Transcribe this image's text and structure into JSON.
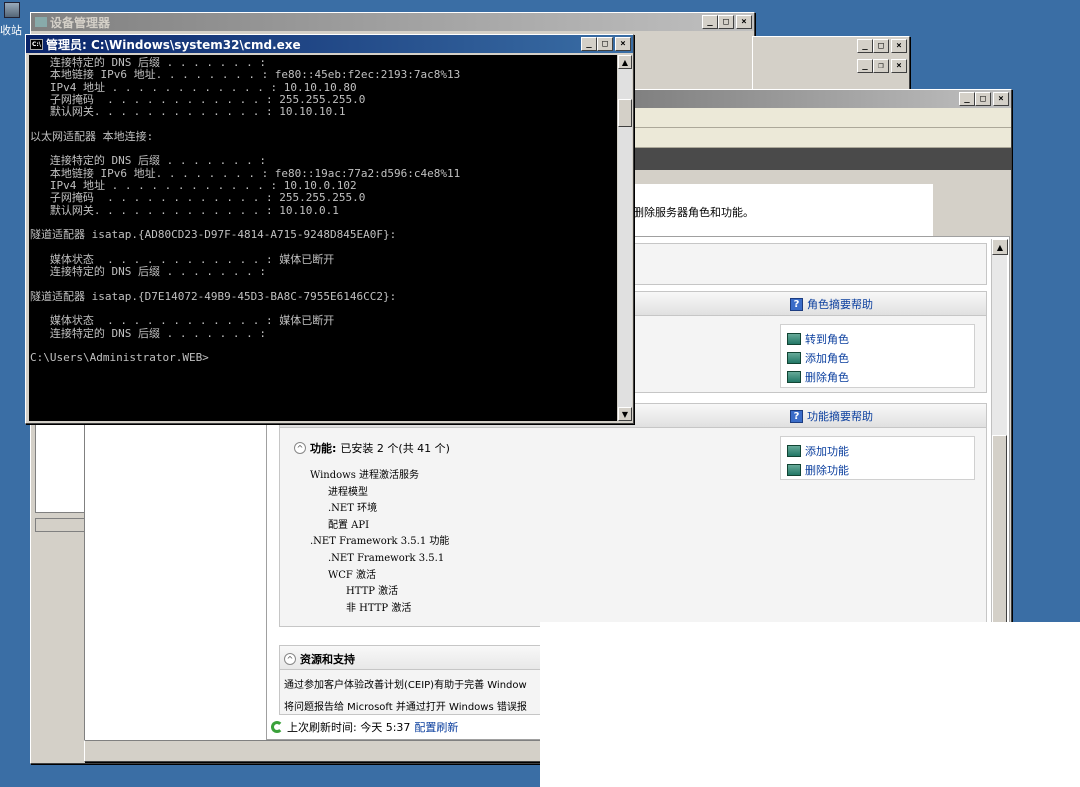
{
  "desktop": {
    "icon_label": "收站"
  },
  "device_manager": {
    "title": "设备管理器"
  },
  "cmd": {
    "title": "管理员: C:\\Windows\\system32\\cmd.exe",
    "lines": [
      "   连接特定的 DNS 后缀 . . . . . . . :",
      "   本地链接 IPv6 地址. . . . . . . . : fe80::45eb:f2ec:2193:7ac8%13",
      "   IPv4 地址 . . . . . . . . . . . . : 10.10.10.80",
      "   子网掩码  . . . . . . . . . . . . : 255.255.255.0",
      "   默认网关. . . . . . . . . . . . . : 10.10.10.1",
      "",
      "以太网适配器 本地连接:",
      "",
      "   连接特定的 DNS 后缀 . . . . . . . :",
      "   本地链接 IPv6 地址. . . . . . . . : fe80::19ac:77a2:d596:c4e8%11",
      "   IPv4 地址 . . . . . . . . . . . . : 10.10.0.102",
      "   子网掩码  . . . . . . . . . . . . : 255.255.255.0",
      "   默认网关. . . . . . . . . . . . . : 10.10.0.1",
      "",
      "隧道适配器 isatap.{AD80CD23-D97F-4814-A715-9248D845EA0F}:",
      "",
      "   媒体状态  . . . . . . . . . . . . : 媒体已断开",
      "   连接特定的 DNS 后缀 . . . . . . . :",
      "",
      "隧道适配器 isatap.{D7E14072-49B9-45D3-BA8C-7955E6146CC2}:",
      "",
      "   媒体状态  . . . . . . . . . . . . : 媒体已断开",
      "   连接特定的 DNS 后缀 . . . . . . . :",
      "",
      "C:\\Users\\Administrator.WEB>"
    ]
  },
  "server_manager": {
    "description_fragment": "删除服务器角色和功能。",
    "roles": {
      "help": "角色摘要帮助",
      "actions": [
        "转到角色",
        "添加角色",
        "删除角色"
      ]
    },
    "features": {
      "help": "功能摘要帮助",
      "title_bold": "功能:",
      "title_rest": "已安装 2 个(共 41 个)",
      "actions": [
        "添加功能",
        "删除功能"
      ],
      "tree": [
        {
          "text": "Windows 进程激活服务",
          "level": 0
        },
        {
          "text": "进程模型",
          "level": 1
        },
        {
          "text": ".NET 环境",
          "level": 1
        },
        {
          "text": "配置 API",
          "level": 1
        },
        {
          "text": ".NET Framework 3.5.1 功能",
          "level": 0
        },
        {
          "text": ".NET Framework 3.5.1",
          "level": 1
        },
        {
          "text": "WCF 激活",
          "level": 1
        },
        {
          "text": "HTTP 激活",
          "level": 2
        },
        {
          "text": "非 HTTP 激活",
          "level": 2
        }
      ]
    },
    "resources": {
      "title": "资源和支持",
      "line1": "通过参加客户体验改善计划(CEIP)有助于完善 Window",
      "line2": "将问题报告给 Microsoft 并通过打开 Windows 错误报"
    },
    "refresh": {
      "label": "上次刷新时间: 今天 5:37",
      "link": "配置刷新"
    }
  }
}
